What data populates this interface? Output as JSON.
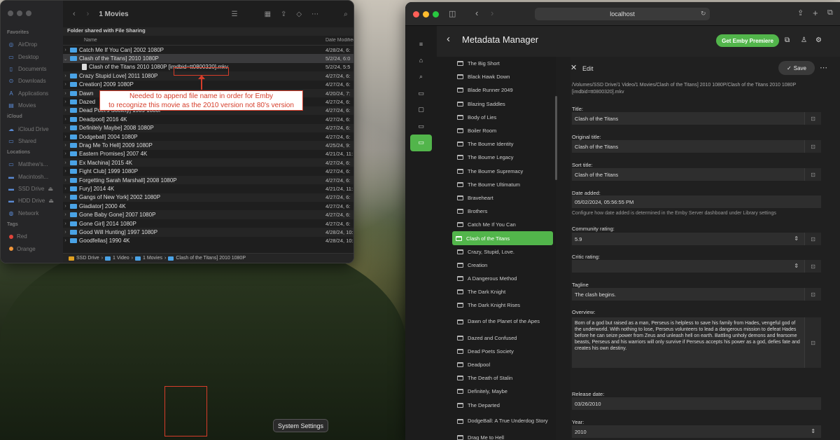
{
  "finder": {
    "title": "1 Movies",
    "sidebar": {
      "favorites_label": "Favorites",
      "favorites": [
        "AirDrop",
        "Desktop",
        "Documents",
        "Downloads",
        "Applications",
        "Movies"
      ],
      "icloud_label": "iCloud",
      "icloud": [
        "iCloud Drive",
        "Shared"
      ],
      "locations_label": "Locations",
      "locations": [
        "Matthew's...",
        "Macintosh...",
        "SSD Drive",
        "HDD Drive",
        "Network"
      ],
      "tags_label": "Tags",
      "tags": [
        {
          "name": "Red",
          "color": "#e0443a"
        },
        {
          "name": "Orange",
          "color": "#f0953a"
        }
      ]
    },
    "share_header": "Folder shared with File Sharing",
    "col_name": "Name",
    "col_date": "Date Modified",
    "rows": [
      {
        "name": "Catch Me If You Can] 2002 1080P",
        "date": "4/28/24, 6:",
        "kind": "folder"
      },
      {
        "name": "Clash of the Titans] 2010 1080P",
        "date": "5/2/24, 6:0",
        "kind": "folder-open"
      },
      {
        "name": "Clash of the Titans 2010 1080P [imdbid=tt0800320].mkv",
        "date": "5/2/24, 5:5",
        "kind": "file"
      },
      {
        "name": "Crazy Stupid Love] 2011 1080P",
        "date": "4/27/24, 6:",
        "kind": "folder"
      },
      {
        "name": "Creation] 2009 1080P",
        "date": "4/27/24, 6:",
        "kind": "folder"
      },
      {
        "name": "Dawn",
        "date": "4/20/24, 7:",
        "kind": "folder"
      },
      {
        "name": "Dazed",
        "date": "4/27/24, 6:",
        "kind": "folder"
      },
      {
        "name": "Dead Poet's Society] 1989 1080P",
        "date": "4/27/24, 6:",
        "kind": "folder"
      },
      {
        "name": "Deadpool] 2016 4K",
        "date": "4/27/24, 6:",
        "kind": "folder"
      },
      {
        "name": "Definitely Maybe] 2008 1080P",
        "date": "4/27/24, 6:",
        "kind": "folder"
      },
      {
        "name": "Dodgeball] 2004 1080P",
        "date": "4/27/24, 6:",
        "kind": "folder"
      },
      {
        "name": "Drag Me To Hell] 2009 1080P",
        "date": "4/25/24, 9:",
        "kind": "folder"
      },
      {
        "name": "Eastern Promises] 2007 4K",
        "date": "4/21/24, 11:",
        "kind": "folder"
      },
      {
        "name": "Ex Machina] 2015 4K",
        "date": "4/27/24, 6:",
        "kind": "folder"
      },
      {
        "name": "Fight Club] 1999 1080P",
        "date": "4/27/24, 6:",
        "kind": "folder"
      },
      {
        "name": "Forgetting Sarah Marshall] 2008 1080P",
        "date": "4/27/24, 6:",
        "kind": "folder"
      },
      {
        "name": "Fury] 2014 4K",
        "date": "4/21/24, 11:",
        "kind": "folder"
      },
      {
        "name": "Gangs of New York] 2002 1080P",
        "date": "4/27/24, 6:",
        "kind": "folder"
      },
      {
        "name": "Gladiator] 2000 4K",
        "date": "4/27/24, 6:",
        "kind": "folder"
      },
      {
        "name": "Gone Baby Gone] 2007 1080P",
        "date": "4/27/24, 6:",
        "kind": "folder"
      },
      {
        "name": "Gone Girl] 2014 1080P",
        "date": "4/27/24, 6:",
        "kind": "folder"
      },
      {
        "name": "Good Will Hunting] 1997 1080P",
        "date": "4/28/24, 10:",
        "kind": "folder"
      },
      {
        "name": "Goodfellas] 1990 4K",
        "date": "4/28/24, 10:",
        "kind": "folder"
      }
    ],
    "path": [
      "SSD Drive",
      "1 Video",
      "1 Movies",
      "Clash of the Titans] 2010 1080P"
    ],
    "annotation_line1": "Needed to append file name in order for Emby",
    "annotation_line2": "to recognize this movie as the 2010 version not 80's version"
  },
  "tooltip": "System Settings",
  "browser": {
    "url": "localhost",
    "app_title": "Metadata Manager",
    "premiere_button": "Get Emby Premiere",
    "library": [
      "The Big Short",
      "Black Hawk Down",
      "Blade Runner 2049",
      "Blazing Saddles",
      "Body of Lies",
      "Boiler Room",
      "The Bourne Identity",
      "The Bourne Legacy",
      "The Bourne Supremacy",
      "The Bourne Ultimatum",
      "Braveheart",
      "Brothers",
      "Catch Me If You Can",
      "Clash of the Titans",
      "Crazy, Stupid, Love.",
      "Creation",
      "A Dangerous Method",
      "The Dark Knight",
      "The Dark Knight Rises",
      "Dawn of the Planet of the Apes",
      "Dazed and Confused",
      "Dead Poets Society",
      "Deadpool",
      "The Death of Stalin",
      "Definitely, Maybe",
      "The Departed",
      "DodgeBall: A True Underdog Story",
      "Drag Me to Hell"
    ],
    "selected_index": 13,
    "edit": {
      "label": "Edit",
      "save": "Save",
      "file_path": "/Volumes/SSD Drive/1 Video/1 Movies/Clash of the Titans] 2010 1080P/Clash of the Titans 2010 1080P [imdbid=tt0800320].mkv",
      "title_label": "Title:",
      "title_value": "Clash of the Titans",
      "original_title_label": "Original title:",
      "original_title_value": "Clash of the Titans",
      "sort_title_label": "Sort title:",
      "sort_title_value": "Clash of the Titans",
      "date_added_label": "Date added:",
      "date_added_value": "05/02/2024, 05:56:55 PM",
      "date_added_hint": "Configure how date added is determined in the Emby Server dashboard under Library settings",
      "community_rating_label": "Community rating:",
      "community_rating_value": "5.9",
      "critic_rating_label": "Critic rating:",
      "critic_rating_value": "",
      "tagline_label": "Tagline",
      "tagline_value": "The clash begins.",
      "overview_label": "Overview:",
      "overview_value": "Born of a god but raised as a man, Perseus is helpless to save his family from Hades, vengeful god of the underworld. With nothing to lose, Perseus volunteers to lead a dangerous mission to defeat Hades before he can seize power from Zeus and unleash hell on earth. Battling unholy demons and fearsome beasts, Perseus and his warriors will only survive if Perseus accepts his power as a god, defies fate and creates his own destiny.",
      "release_date_label": "Release date:",
      "release_date_value": "03/26/2010",
      "year_label": "Year:",
      "year_value": "2010"
    }
  }
}
